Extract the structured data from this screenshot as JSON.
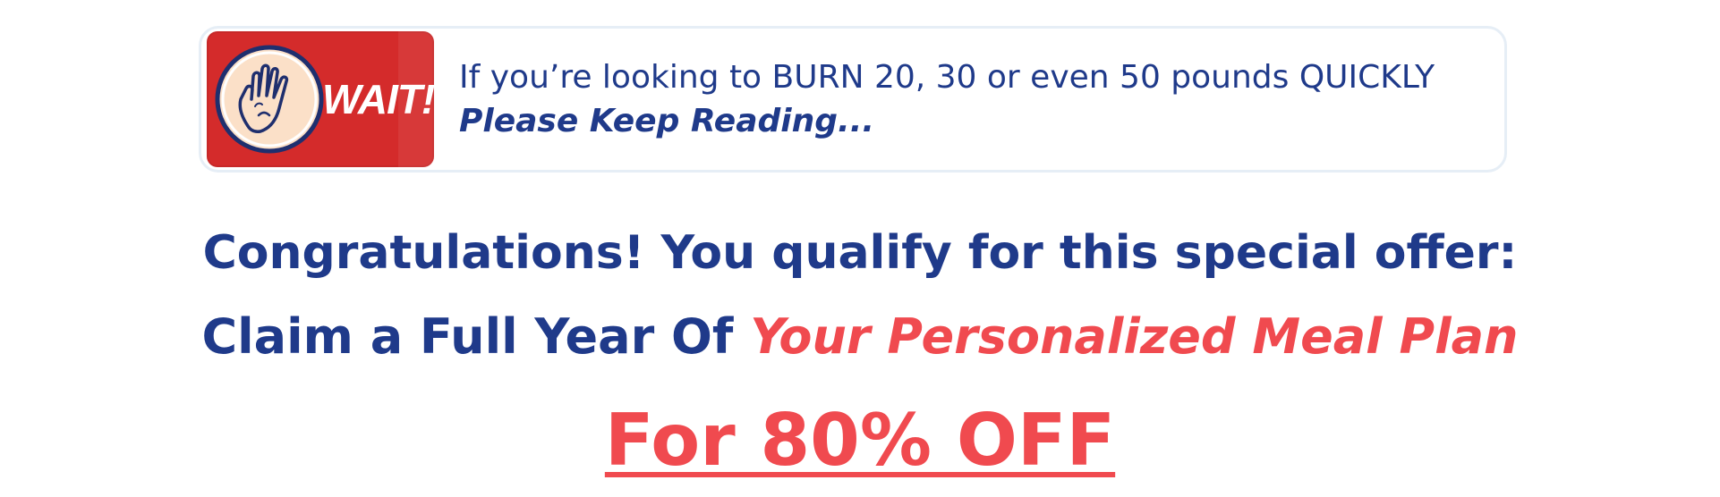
{
  "banner": {
    "badge_label": "WAIT!",
    "badge_icon": "raised-hand-icon",
    "line1": "If you’re looking to BURN 20, 30 or even 50 pounds QUICKLY",
    "line2": "Please Keep Reading..."
  },
  "headline": {
    "line1": "Congratulations! You qualify for this special offer:",
    "line2_prefix": "Claim a Full Year Of ",
    "line2_highlight": "Your Personalized Meal Plan"
  },
  "offer": {
    "text": "For 80% OFF"
  },
  "colors": {
    "navy": "#1f3a8a",
    "red": "#f04a4f",
    "badge_red": "#d42b2b",
    "banner_border": "#e6eef6"
  }
}
